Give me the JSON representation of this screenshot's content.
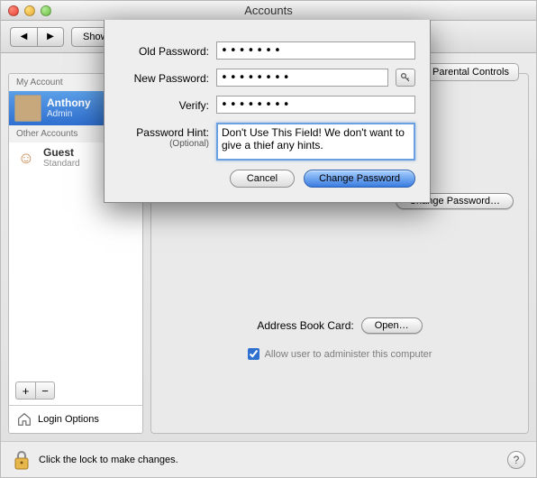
{
  "window": {
    "title": "Accounts"
  },
  "toolbar": {
    "showall": "Show All"
  },
  "sidebar": {
    "my_account_hdr": "My Account",
    "other_hdr": "Other Accounts",
    "me": {
      "name": "Anthony",
      "role": "Admin"
    },
    "guest": {
      "name": "Guest",
      "role": "Standard"
    },
    "login_options": "Login Options"
  },
  "plusminus": {
    "plus": "+",
    "minus": "−"
  },
  "tabs": {
    "controls": "Parental Controls"
  },
  "main": {
    "change_pw_btn": "Change Password…",
    "address_label": "Address Book Card:",
    "open_btn": "Open…",
    "admin_check": "Allow user to administer this computer"
  },
  "sheet": {
    "old_label": "Old Password:",
    "new_label": "New Password:",
    "verify_label": "Verify:",
    "hint_label": "Password Hint:",
    "hint_optional": "(Optional)",
    "old_val": "•••••••",
    "new_val": "••••••••",
    "verify_val": "••••••••",
    "hint_val": "Don't Use This Field! We don't want to give a thief any hints.",
    "cancel": "Cancel",
    "change": "Change Password"
  },
  "footer": {
    "lock_text": "Click the lock to make changes."
  }
}
